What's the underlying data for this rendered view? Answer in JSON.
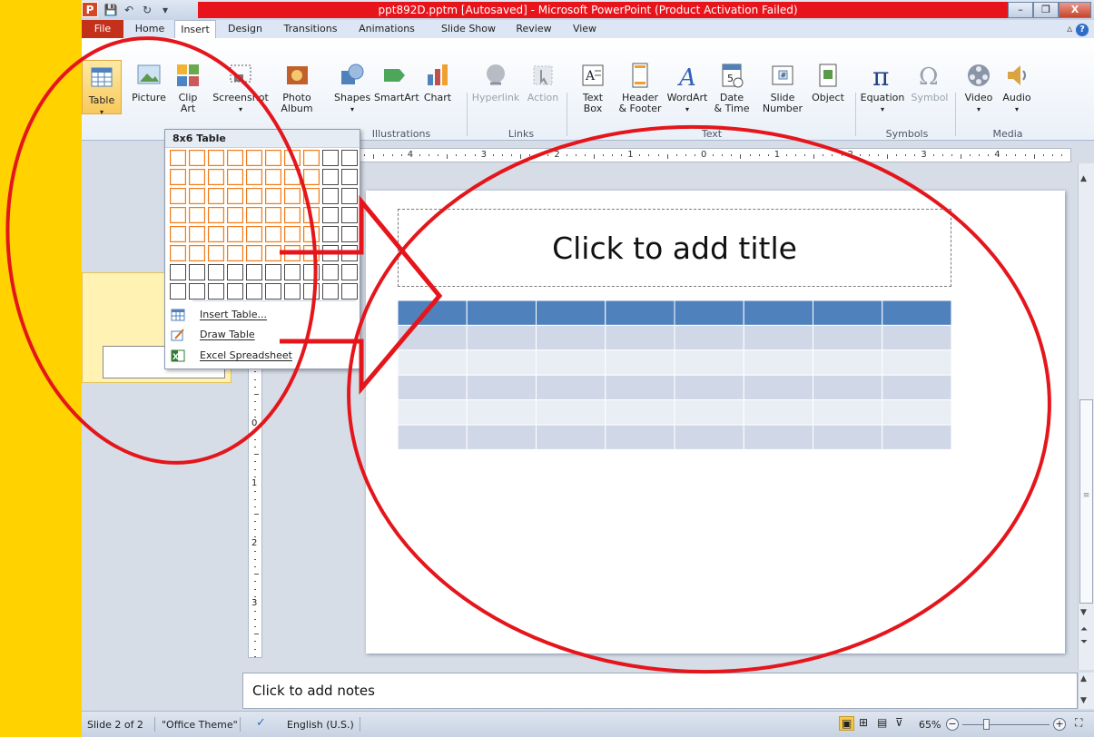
{
  "window": {
    "title": "ppt892D.pptm [Autosaved]  -  Microsoft PowerPoint (Product Activation Failed)",
    "app_icon_letter": "P",
    "minimize": "–",
    "restore": "❐",
    "close": "X"
  },
  "tabs": [
    "File",
    "Home",
    "Insert",
    "Design",
    "Transitions",
    "Animations",
    "Slide Show",
    "Review",
    "View"
  ],
  "active_tab": "Insert",
  "ribbon": {
    "buttons": {
      "table": "Table",
      "picture": "Picture",
      "clip_art_1": "Clip",
      "clip_art_2": "Art",
      "screenshot": "Screenshot",
      "photo_album_1": "Photo",
      "photo_album_2": "Album",
      "shapes": "Shapes",
      "smartart": "SmartArt",
      "chart": "Chart",
      "hyperlink": "Hyperlink",
      "action": "Action",
      "text_box_1": "Text",
      "text_box_2": "Box",
      "header_footer_1": "Header",
      "header_footer_2": "& Footer",
      "wordart": "WordArt",
      "date_time_1": "Date",
      "date_time_2": "& Time",
      "slide_number_1": "Slide",
      "slide_number_2": "Number",
      "object": "Object",
      "equation": "Equation",
      "symbol": "Symbol",
      "video": "Video",
      "audio": "Audio"
    },
    "groups": {
      "illustrations": "Illustrations",
      "links": "Links",
      "text": "Text",
      "symbols": "Symbols",
      "media": "Media"
    }
  },
  "table_dropdown": {
    "header": "8x6 Table",
    "cols_total": 10,
    "rows_total": 8,
    "selected_cols": 8,
    "selected_rows": 6,
    "items": [
      "Insert Table...",
      "Draw Table",
      "Excel Spreadsheet"
    ]
  },
  "ruler": {
    "h_labels": [
      "4",
      "3",
      "2",
      "1",
      "0",
      "1",
      "2",
      "3",
      "4"
    ],
    "v_labels": [
      "0",
      "1",
      "2",
      "3"
    ]
  },
  "slide": {
    "title_placeholder": "Click to add title",
    "table_rows": 6,
    "table_cols": 8,
    "colors": {
      "header": "#4f81bd",
      "band_dark": "#d0d8e8",
      "band_light": "#e9edf4"
    }
  },
  "notes": {
    "placeholder": "Click to add notes"
  },
  "status_bar": {
    "slide": "Slide 2 of 2",
    "theme": "\"Office Theme\"",
    "language": "English (U.S.)",
    "zoom": "65%"
  },
  "colors": {
    "background_frame": "#ffd200",
    "annotation": "#e4161c",
    "title_bar_highlight": "#e8141c"
  }
}
